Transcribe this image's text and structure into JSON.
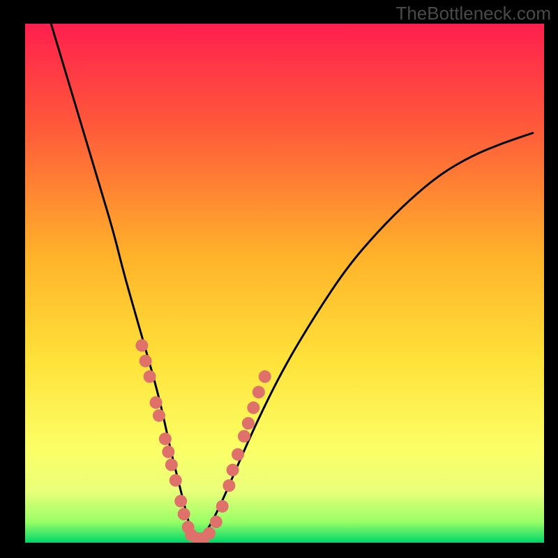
{
  "watermark": {
    "text": "TheBottleneck.com"
  },
  "colors": {
    "gradient_stops": [
      {
        "pct": 0,
        "color": "#ff1f4e"
      },
      {
        "pct": 20,
        "color": "#ff5a3a"
      },
      {
        "pct": 45,
        "color": "#ffb32a"
      },
      {
        "pct": 65,
        "color": "#ffe23a"
      },
      {
        "pct": 82,
        "color": "#fbff66"
      },
      {
        "pct": 90,
        "color": "#eaff7a"
      },
      {
        "pct": 96,
        "color": "#99ff66"
      },
      {
        "pct": 100,
        "color": "#00d66a"
      }
    ],
    "curve_stroke": "#000000",
    "dot_fill": "#e0716a",
    "background": "#000000"
  },
  "chart_data": {
    "type": "line",
    "title": "",
    "xlabel": "",
    "ylabel": "",
    "xlim": [
      0,
      100
    ],
    "ylim": [
      0,
      100
    ],
    "series": [
      {
        "name": "v-curve",
        "x": [
          5,
          8,
          11,
          14,
          17,
          19,
          21,
          23,
          25,
          26.5,
          28,
          29.5,
          31,
          32,
          33,
          35,
          38,
          41,
          45,
          50,
          56,
          62,
          68,
          74,
          80,
          86,
          92,
          98
        ],
        "values": [
          100,
          90,
          80,
          70,
          60,
          52,
          45,
          38,
          31,
          25,
          18,
          12,
          6,
          2,
          0.5,
          2,
          8,
          15,
          24,
          34,
          44,
          53,
          60,
          66,
          71,
          74.5,
          77,
          79
        ]
      }
    ],
    "markers": [
      {
        "x": 22.5,
        "y": 38
      },
      {
        "x": 23.2,
        "y": 35
      },
      {
        "x": 24.0,
        "y": 32
      },
      {
        "x": 25.2,
        "y": 27
      },
      {
        "x": 25.8,
        "y": 24.5
      },
      {
        "x": 27.0,
        "y": 20
      },
      {
        "x": 27.6,
        "y": 17.5
      },
      {
        "x": 28.2,
        "y": 15
      },
      {
        "x": 29.0,
        "y": 12
      },
      {
        "x": 30.0,
        "y": 8
      },
      {
        "x": 30.6,
        "y": 5.5
      },
      {
        "x": 31.4,
        "y": 3
      },
      {
        "x": 32.0,
        "y": 1.5
      },
      {
        "x": 33.2,
        "y": 0.8
      },
      {
        "x": 34.3,
        "y": 0.8
      },
      {
        "x": 35.5,
        "y": 1.8
      },
      {
        "x": 36.8,
        "y": 4
      },
      {
        "x": 38.0,
        "y": 7
      },
      {
        "x": 39.3,
        "y": 11
      },
      {
        "x": 40.0,
        "y": 14
      },
      {
        "x": 41.0,
        "y": 17
      },
      {
        "x": 42.2,
        "y": 20.5
      },
      {
        "x": 43.0,
        "y": 23
      },
      {
        "x": 44.0,
        "y": 26
      },
      {
        "x": 45.0,
        "y": 29
      },
      {
        "x": 46.2,
        "y": 32
      }
    ]
  }
}
